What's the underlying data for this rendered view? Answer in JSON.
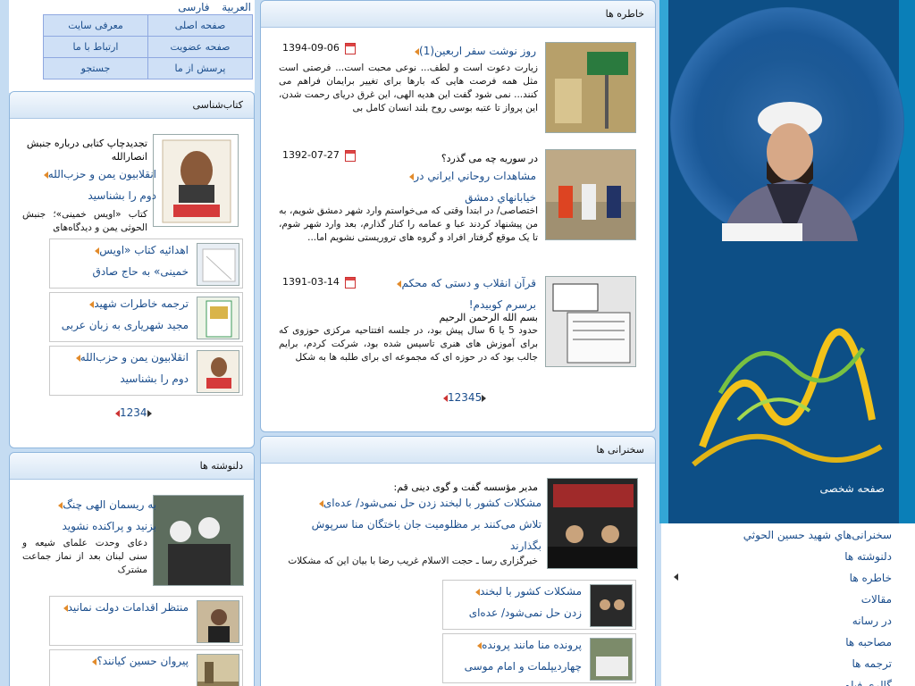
{
  "languages": [
    "العربية",
    "فارسی"
  ],
  "topnav": [
    [
      "صفحه اصلی",
      "معرفی سایت"
    ],
    [
      "صفحه عضویت",
      "ارتباط با ما"
    ],
    [
      "پرسش از ما",
      "جستجو"
    ]
  ],
  "banner": {
    "caption": "صفحه شخصی"
  },
  "sidenav": [
    "سخنرانی‌هاي شهيد حسين الحوثي",
    "دلنوشته ها",
    "خاطره ها",
    "مقالات",
    "در رسانه",
    "مصاحبه ها",
    "ترجمه ها",
    "گالری فیلم"
  ],
  "memories": {
    "title": "خاطره ها",
    "items": [
      {
        "date": "1394-09-06",
        "title": "روز نوشت سفر اربعین(1)",
        "title2": "",
        "lead": "",
        "text": "زيارت دعوت است و لطف... نوعی محبت است... فرصتی است مثل همه فرصت هایی که بارها برای تغییر برایمان فراهم می کنند... نمی شود گفت این هدیه الهی، این غرق دریای رحمت شدن، این پرواز تا عتبه بوسی روح بلند انسان کامل بی"
      },
      {
        "date": "1392-07-27",
        "title": "مشاهدات روحاني ايراني در",
        "title2": "خيابانهاي دمشق",
        "lead": "در سوریه چه می گذرد؟",
        "text": "اختصاصی/ در ابتدا وقتی که می‌خواستم وارد شهر دمشق شویم، به من پیشنهاد کردند عبا و عمامه را کنار گذارم، بعد وارد شهر شوم، تا یک موقع گرفتار افراد و گروه های تروریستی نشویم اما..."
      },
      {
        "date": "1391-03-14",
        "title": "قرآن انقلاب و دستی که محکم",
        "title2": "برسرم کوبیدم!",
        "lead": "بسم الله الرحمن الرحیم",
        "text": "حدود 5 یا 6 سال پیش بود، در جلسه افتتاحیه مرکزی حوزوی که برای آموزش های هنری تاسیس شده بود، شرکت کردم، برایم جالب بود که در حوزه ای که مجموعه ای برای طلبه ها به شکل"
      }
    ],
    "pager": [
      "1",
      "2",
      "3",
      "4",
      "5"
    ]
  },
  "books": {
    "title": "کتاب‌شناسی",
    "featured": {
      "lead": "تجدیدچاپ کتابی درباره جنبش انصارالله",
      "link1": "انقلابیون یمن و حزب‌الله",
      "link2": "دوم را بشناسید",
      "text": "کتاب «اویس خمینی»؛ جنبش الحوثی یمن و دیدگاه‌های"
    },
    "items": [
      {
        "link1": "اهدائیه کتاب «اویس",
        "link2": "خمینی» به حاج صادق"
      },
      {
        "link1": "ترجمه خاطرات شهید",
        "link2": "مجید شهریاری به زبان عربی"
      },
      {
        "link1": "انقلابیون یمن و حزب‌الله",
        "link2": "دوم را بشناسید"
      }
    ],
    "pager": [
      "1",
      "2",
      "3",
      "4"
    ],
    "cover_text": "اویس خمینی"
  },
  "speeches": {
    "title": "سخنرانی ها",
    "featured": {
      "lead": "مدیر مؤسسه گفت و گوی دینی قم:",
      "link1": "مشکلات کشور با لبخند زدن حل نمی‌شود/ عده‌ای",
      "link2": "تلاش می‌کنند بر مظلومیت جان باختگان منا سرپوش",
      "link3": "بگذارند",
      "text": "خبرگزاری رسا ـ حجت الاسلام غریب رضا با بیان این که مشکلات"
    },
    "items": [
      {
        "link1": "مشکلات کشور با لبخند",
        "link2": "زدن حل نمی‌شود/ عده‌ای"
      },
      {
        "link1": "پرونده منا مانند پرونده",
        "link2": "چهاردیپلمات و امام موسی"
      }
    ]
  },
  "diary": {
    "title": "دلنوشته ها",
    "featured": {
      "link1": "به ریسمان الهی چنگ",
      "link2": "بزنید و پراکنده نشوید",
      "text": "دعای وحدت علمای شیعه و سنی لبنان بعد از نماز جماعت مشترک"
    },
    "items": [
      {
        "link1": "منتظر اقدامات دولت نمانید"
      },
      {
        "link1": "پیروان حسین کیانند؟"
      }
    ]
  },
  "colors": {
    "accent": "#1a4d8c",
    "banner": "#0d4f86",
    "page_bg": "#c5dcf2",
    "arrow": "#e28b2b"
  }
}
